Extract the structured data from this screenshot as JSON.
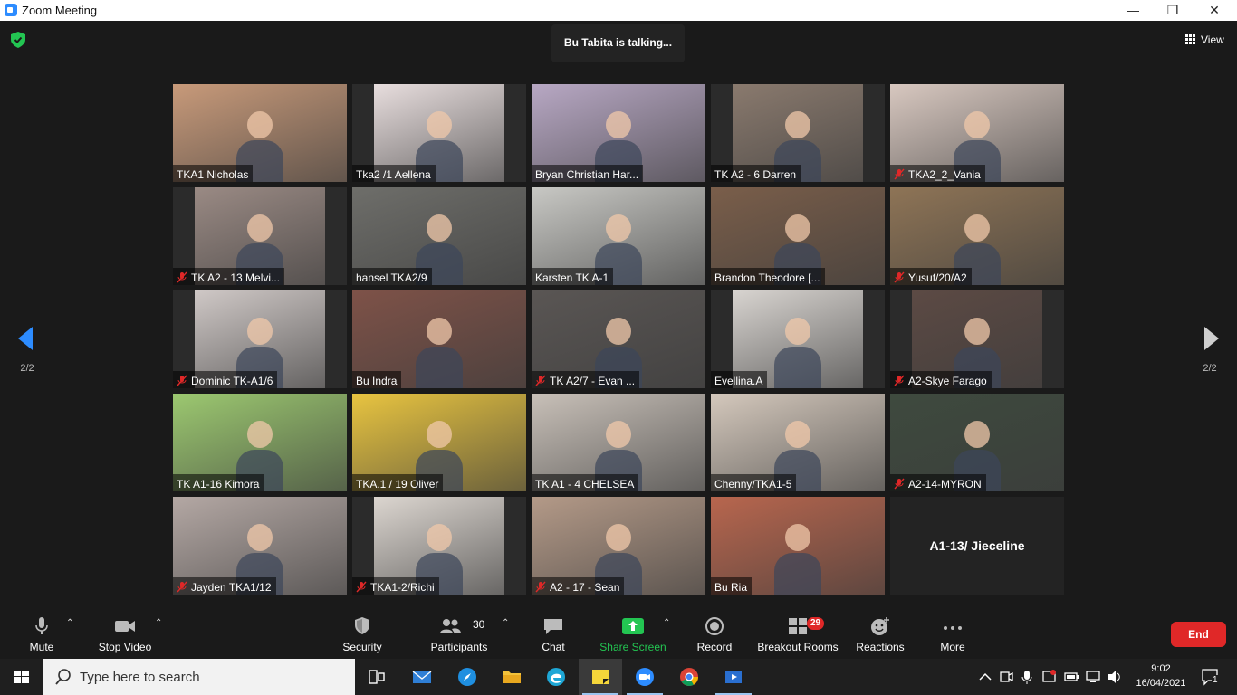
{
  "window": {
    "title": "Zoom Meeting",
    "minimize": "—",
    "restore": "❐",
    "close": "✕"
  },
  "meeting": {
    "talking": "Bu Tabita is talking...",
    "view_label": "View",
    "page_left": "2/2",
    "page_right": "2/2"
  },
  "tiles": [
    {
      "name": "TKA1 Nicholas",
      "muted": false,
      "bg": "#c89a7a"
    },
    {
      "name": "Tka2 /1 Aellena",
      "muted": false,
      "bg": "#e8dede"
    },
    {
      "name": "Bryan Christian Har...",
      "muted": false,
      "bg": "#b8a8c4"
    },
    {
      "name": "TK A2 - 6 Darren",
      "muted": false,
      "bg": "#8a7a6e"
    },
    {
      "name": "TKA2_2_Vania",
      "muted": true,
      "bg": "#d8c8c0"
    },
    {
      "name": "TK A2 - 13 Melvi...",
      "muted": true,
      "bg": "#9a8a84"
    },
    {
      "name": "hansel TKA2/9",
      "muted": false,
      "bg": "#6e6e6a"
    },
    {
      "name": "Karsten TK A-1",
      "muted": false,
      "bg": "#c8c8c4"
    },
    {
      "name": "Brandon Theodore [...",
      "muted": false,
      "bg": "#7a5e4a"
    },
    {
      "name": "Yusuf/20/A2",
      "muted": true,
      "bg": "#8e7456"
    },
    {
      "name": "Dominic TK-A1/6",
      "muted": true,
      "bg": "#cfc8c6"
    },
    {
      "name": "Bu Indra",
      "muted": false,
      "bg": "#7e5248"
    },
    {
      "name": "TK A2/7  -  Evan ...",
      "muted": true,
      "bg": "#5a5654"
    },
    {
      "name": "Evellina.A",
      "muted": false,
      "bg": "#d8d4d0"
    },
    {
      "name": "A2-Skye Farago",
      "muted": true,
      "bg": "#5c4a44"
    },
    {
      "name": "TK A1-16 Kimora",
      "muted": false,
      "bg": "#9cc870"
    },
    {
      "name": "TKA.1 / 19 Oliver",
      "muted": false,
      "bg": "#e8c440"
    },
    {
      "name": "TK A1 - 4 CHELSEA",
      "muted": false,
      "bg": "#c8c0b8"
    },
    {
      "name": "Chenny/TKA1-5",
      "muted": false,
      "bg": "#d4c8bc"
    },
    {
      "name": "A2-14-MYRON",
      "muted": true,
      "bg": "#3e4a3e"
    },
    {
      "name": "Jayden TKA1/12",
      "muted": true,
      "bg": "#b4a8a4"
    },
    {
      "name": "TKA1-2/Richi",
      "muted": true,
      "bg": "#dcd6d0"
    },
    {
      "name": "A2 - 17 - Sean",
      "muted": true,
      "bg": "#b49a88"
    },
    {
      "name": "Bu Ria",
      "muted": false,
      "bg": "#b8664e"
    },
    {
      "name": "A1-13/ Jieceline",
      "muted": false,
      "novideo": true
    }
  ],
  "toolbar": {
    "mute": "Mute",
    "stop_video": "Stop Video",
    "security": "Security",
    "participants": "Participants",
    "participants_count": "30",
    "chat": "Chat",
    "share_screen": "Share Screen",
    "record": "Record",
    "breakout": "Breakout Rooms",
    "breakout_badge": "29",
    "reactions": "Reactions",
    "more": "More",
    "end": "End"
  },
  "taskbar": {
    "search_placeholder": "Type here to search",
    "time": "9:02",
    "date": "16/04/2021",
    "notification_count": "1"
  },
  "colors": {
    "accent": "#2d8cff",
    "share_green": "#23c552",
    "end_red": "#e02828",
    "badge_red": "#e02828"
  }
}
